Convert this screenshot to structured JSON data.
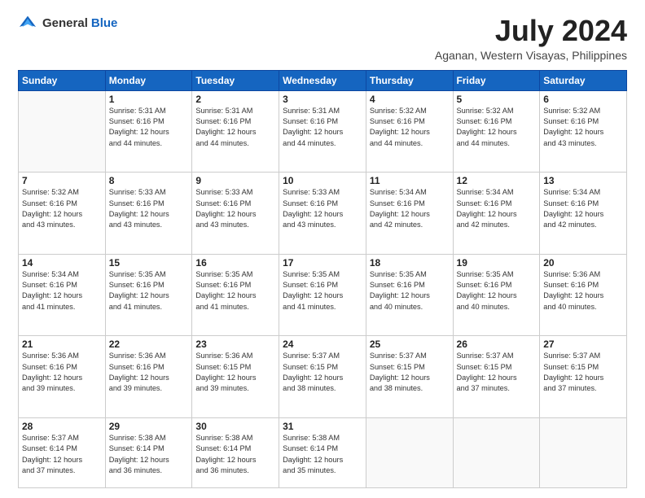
{
  "logo": {
    "text_general": "General",
    "text_blue": "Blue"
  },
  "header": {
    "month_year": "July 2024",
    "location": "Aganan, Western Visayas, Philippines"
  },
  "weekdays": [
    "Sunday",
    "Monday",
    "Tuesday",
    "Wednesday",
    "Thursday",
    "Friday",
    "Saturday"
  ],
  "weeks": [
    [
      {
        "day": "",
        "info": ""
      },
      {
        "day": "1",
        "info": "Sunrise: 5:31 AM\nSunset: 6:16 PM\nDaylight: 12 hours\nand 44 minutes."
      },
      {
        "day": "2",
        "info": "Sunrise: 5:31 AM\nSunset: 6:16 PM\nDaylight: 12 hours\nand 44 minutes."
      },
      {
        "day": "3",
        "info": "Sunrise: 5:31 AM\nSunset: 6:16 PM\nDaylight: 12 hours\nand 44 minutes."
      },
      {
        "day": "4",
        "info": "Sunrise: 5:32 AM\nSunset: 6:16 PM\nDaylight: 12 hours\nand 44 minutes."
      },
      {
        "day": "5",
        "info": "Sunrise: 5:32 AM\nSunset: 6:16 PM\nDaylight: 12 hours\nand 44 minutes."
      },
      {
        "day": "6",
        "info": "Sunrise: 5:32 AM\nSunset: 6:16 PM\nDaylight: 12 hours\nand 43 minutes."
      }
    ],
    [
      {
        "day": "7",
        "info": "Sunrise: 5:32 AM\nSunset: 6:16 PM\nDaylight: 12 hours\nand 43 minutes."
      },
      {
        "day": "8",
        "info": "Sunrise: 5:33 AM\nSunset: 6:16 PM\nDaylight: 12 hours\nand 43 minutes."
      },
      {
        "day": "9",
        "info": "Sunrise: 5:33 AM\nSunset: 6:16 PM\nDaylight: 12 hours\nand 43 minutes."
      },
      {
        "day": "10",
        "info": "Sunrise: 5:33 AM\nSunset: 6:16 PM\nDaylight: 12 hours\nand 43 minutes."
      },
      {
        "day": "11",
        "info": "Sunrise: 5:34 AM\nSunset: 6:16 PM\nDaylight: 12 hours\nand 42 minutes."
      },
      {
        "day": "12",
        "info": "Sunrise: 5:34 AM\nSunset: 6:16 PM\nDaylight: 12 hours\nand 42 minutes."
      },
      {
        "day": "13",
        "info": "Sunrise: 5:34 AM\nSunset: 6:16 PM\nDaylight: 12 hours\nand 42 minutes."
      }
    ],
    [
      {
        "day": "14",
        "info": "Sunrise: 5:34 AM\nSunset: 6:16 PM\nDaylight: 12 hours\nand 41 minutes."
      },
      {
        "day": "15",
        "info": "Sunrise: 5:35 AM\nSunset: 6:16 PM\nDaylight: 12 hours\nand 41 minutes."
      },
      {
        "day": "16",
        "info": "Sunrise: 5:35 AM\nSunset: 6:16 PM\nDaylight: 12 hours\nand 41 minutes."
      },
      {
        "day": "17",
        "info": "Sunrise: 5:35 AM\nSunset: 6:16 PM\nDaylight: 12 hours\nand 41 minutes."
      },
      {
        "day": "18",
        "info": "Sunrise: 5:35 AM\nSunset: 6:16 PM\nDaylight: 12 hours\nand 40 minutes."
      },
      {
        "day": "19",
        "info": "Sunrise: 5:35 AM\nSunset: 6:16 PM\nDaylight: 12 hours\nand 40 minutes."
      },
      {
        "day": "20",
        "info": "Sunrise: 5:36 AM\nSunset: 6:16 PM\nDaylight: 12 hours\nand 40 minutes."
      }
    ],
    [
      {
        "day": "21",
        "info": "Sunrise: 5:36 AM\nSunset: 6:16 PM\nDaylight: 12 hours\nand 39 minutes."
      },
      {
        "day": "22",
        "info": "Sunrise: 5:36 AM\nSunset: 6:16 PM\nDaylight: 12 hours\nand 39 minutes."
      },
      {
        "day": "23",
        "info": "Sunrise: 5:36 AM\nSunset: 6:15 PM\nDaylight: 12 hours\nand 39 minutes."
      },
      {
        "day": "24",
        "info": "Sunrise: 5:37 AM\nSunset: 6:15 PM\nDaylight: 12 hours\nand 38 minutes."
      },
      {
        "day": "25",
        "info": "Sunrise: 5:37 AM\nSunset: 6:15 PM\nDaylight: 12 hours\nand 38 minutes."
      },
      {
        "day": "26",
        "info": "Sunrise: 5:37 AM\nSunset: 6:15 PM\nDaylight: 12 hours\nand 37 minutes."
      },
      {
        "day": "27",
        "info": "Sunrise: 5:37 AM\nSunset: 6:15 PM\nDaylight: 12 hours\nand 37 minutes."
      }
    ],
    [
      {
        "day": "28",
        "info": "Sunrise: 5:37 AM\nSunset: 6:14 PM\nDaylight: 12 hours\nand 37 minutes."
      },
      {
        "day": "29",
        "info": "Sunrise: 5:38 AM\nSunset: 6:14 PM\nDaylight: 12 hours\nand 36 minutes."
      },
      {
        "day": "30",
        "info": "Sunrise: 5:38 AM\nSunset: 6:14 PM\nDaylight: 12 hours\nand 36 minutes."
      },
      {
        "day": "31",
        "info": "Sunrise: 5:38 AM\nSunset: 6:14 PM\nDaylight: 12 hours\nand 35 minutes."
      },
      {
        "day": "",
        "info": ""
      },
      {
        "day": "",
        "info": ""
      },
      {
        "day": "",
        "info": ""
      }
    ]
  ]
}
